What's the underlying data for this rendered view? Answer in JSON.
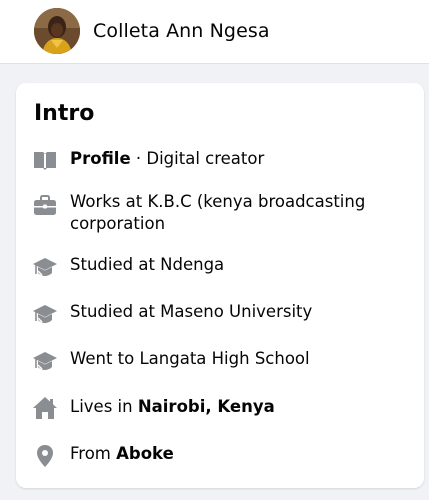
{
  "header": {
    "name": "Colleta Ann Ngesa",
    "avatar_icon": "profile-photo"
  },
  "intro": {
    "title": "Intro",
    "items": [
      {
        "icon": "book-page-icon",
        "bold": "Profile",
        "text": " · Digital creator"
      },
      {
        "icon": "briefcase-icon",
        "text": "Works at K.B.C (kenya broadcasting corporation"
      },
      {
        "icon": "graduation-cap-icon",
        "text": "Studied at Ndenga"
      },
      {
        "icon": "graduation-cap-icon",
        "text": "Studied at Maseno University"
      },
      {
        "icon": "graduation-cap-icon",
        "text": "Went to Langata High School"
      },
      {
        "icon": "house-icon",
        "prefix": "Lives in ",
        "bold": "Nairobi, Kenya"
      },
      {
        "icon": "location-pin-icon",
        "prefix": "From ",
        "bold": "Aboke"
      }
    ]
  },
  "colors": {
    "icon_gray": "#8a8d91",
    "background": "#f0f2f5",
    "card": "#ffffff",
    "text": "#050505"
  }
}
